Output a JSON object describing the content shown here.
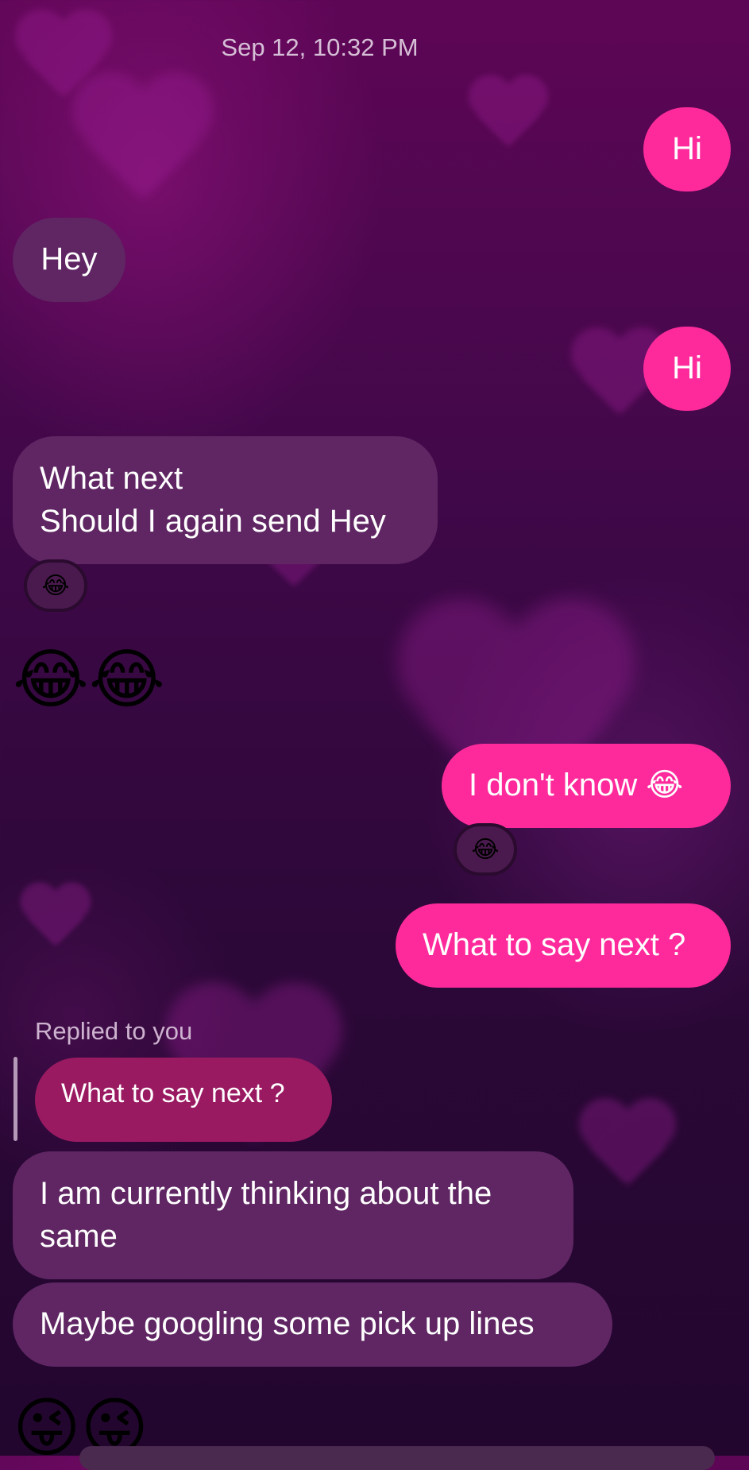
{
  "timestamp": "Sep 12, 10:32 PM",
  "messages": [
    {
      "text": "Hi"
    },
    {
      "text": "Hey"
    },
    {
      "text": "Hi"
    },
    {
      "text": "What next\nShould I again send Hey",
      "reaction": "😂"
    },
    {
      "text": "😂😂"
    },
    {
      "text": "I don't know 😂",
      "reaction": "😂"
    },
    {
      "text": "What to say next ?"
    },
    {
      "reply_label": "Replied to you",
      "quoted": "What to say next ?"
    },
    {
      "text": "I am currently thinking about the same"
    },
    {
      "text": "Maybe googling some pick up lines"
    },
    {
      "text": "😜😜"
    }
  ]
}
